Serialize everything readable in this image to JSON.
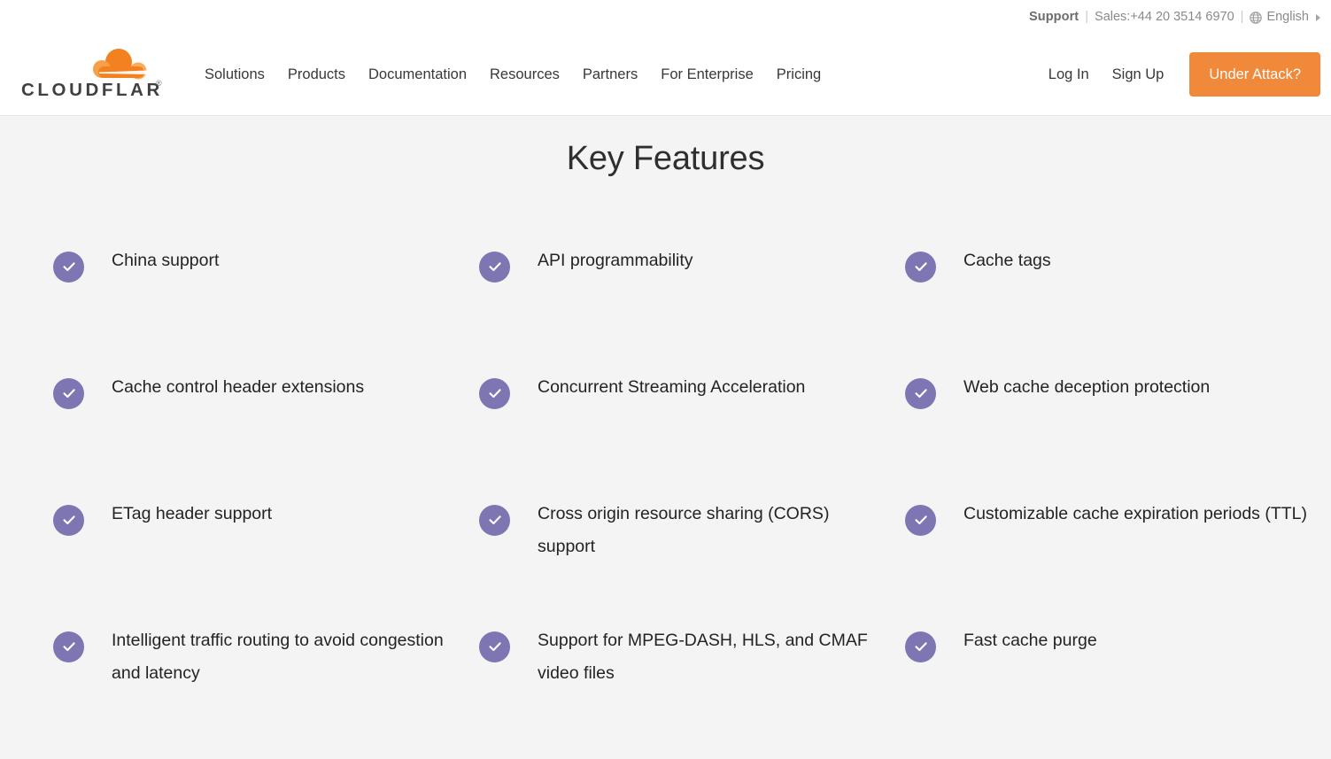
{
  "utility_bar": {
    "support_label": "Support",
    "separator": "|",
    "sales_label": "Sales:+44 20 3514 6970",
    "language_label": "English",
    "globe_icon": "globe-icon",
    "caret_icon": "caret-right-icon"
  },
  "header": {
    "logo_text": "CLOUDFLARE",
    "logo_icon": "cloudflare-cloud-logo",
    "nav": [
      {
        "label": "Solutions"
      },
      {
        "label": "Products"
      },
      {
        "label": "Documentation"
      },
      {
        "label": "Resources"
      },
      {
        "label": "Partners"
      },
      {
        "label": "For Enterprise"
      },
      {
        "label": "Pricing"
      }
    ],
    "login_label": "Log In",
    "signup_label": "Sign Up",
    "under_attack_label": "Under Attack?",
    "accent_orange": "#f1893a"
  },
  "features": {
    "title": "Key Features",
    "check_color": "#7d76b3",
    "background": "#f4f4f4",
    "items": [
      {
        "label": "China support"
      },
      {
        "label": "API programmability"
      },
      {
        "label": "Cache tags"
      },
      {
        "label": "Cache control header extensions"
      },
      {
        "label": "Concurrent Streaming Acceleration"
      },
      {
        "label": "Web cache deception protection"
      },
      {
        "label": "ETag header support"
      },
      {
        "label": "Cross origin resource sharing (CORS) support"
      },
      {
        "label": "Customizable cache expiration periods (TTL)"
      },
      {
        "label": "Intelligent traffic routing to avoid congestion and latency"
      },
      {
        "label": "Support for MPEG-DASH, HLS, and CMAF video files"
      },
      {
        "label": "Fast cache purge"
      }
    ]
  }
}
